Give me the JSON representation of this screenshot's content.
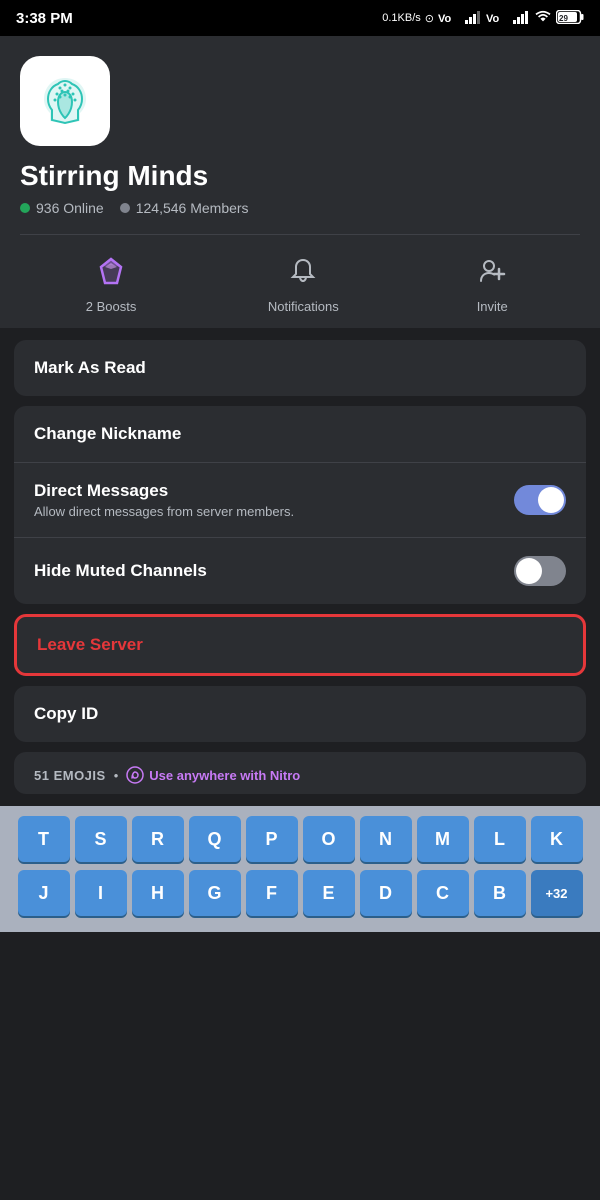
{
  "status_bar": {
    "time": "3:38 PM",
    "network": "0.1KB/s",
    "battery": "29"
  },
  "server": {
    "name": "Stirring Minds",
    "online": "936 Online",
    "members": "124,546 Members"
  },
  "actions": {
    "boosts_label": "2 Boosts",
    "notifications_label": "Notifications",
    "invite_label": "Invite"
  },
  "menu": {
    "mark_as_read": "Mark As Read",
    "change_nickname": "Change Nickname",
    "direct_messages_label": "Direct Messages",
    "direct_messages_sub": "Allow direct messages from server members.",
    "direct_messages_on": true,
    "hide_muted_label": "Hide Muted Channels",
    "hide_muted_on": false,
    "leave_server": "Leave Server",
    "copy_id": "Copy ID"
  },
  "emojis": {
    "header": "51 EMOJIS",
    "nitro_text": "Use anywhere with Nitro"
  },
  "keyboard": {
    "row1": [
      "T",
      "S",
      "R",
      "Q",
      "P",
      "O",
      "N",
      "M",
      "L",
      "K"
    ],
    "row2": [
      "J",
      "I",
      "H",
      "G",
      "F",
      "E",
      "D",
      "C",
      "B"
    ],
    "more": "+32"
  }
}
